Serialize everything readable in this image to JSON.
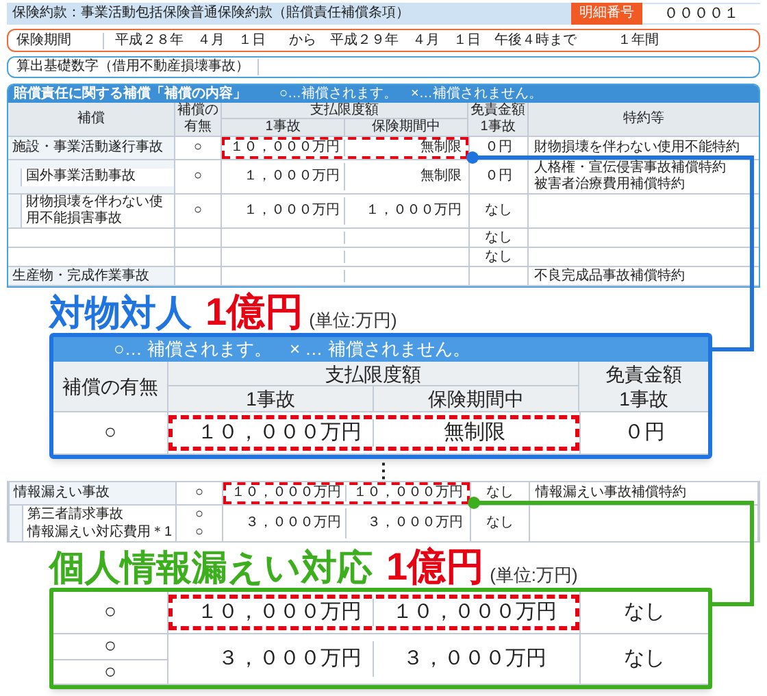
{
  "header": {
    "title": "保険約款：事業活動包括保険普通保険約款（賠償責任補償条項）",
    "badge": "明細番号",
    "number": "００００１"
  },
  "period": {
    "label": "保険期間",
    "start": "平成２８年　４月　１日",
    "end": "から　平成２９年　４月　１日　午後４時まで",
    "length": "１年間"
  },
  "basis": {
    "label": "算出基礎数字（借用不動産損壊事故）"
  },
  "section": {
    "title": "賠償責任に関する補償「補償の内容」",
    "legend": "○…補償されます。　×…補償されません。"
  },
  "columns": {
    "coverage": "補償",
    "availability": "補償の有無",
    "limit": "支払限度額",
    "per_accident": "1事故",
    "per_period": "保険期間中",
    "deductible": "免責金額",
    "deductible_sub": "1事故",
    "riders": "特約等"
  },
  "rows": [
    {
      "sub": false,
      "highlighted": true,
      "items": [
        {
          "label": "施設・事業活動遂行事故",
          "mark": "○"
        }
      ],
      "per_accident": "１０，０００万円",
      "per_period": "無制限",
      "deductible": "０円",
      "riders": [
        "財物損壊を伴わない使用不能特約"
      ]
    },
    {
      "sub": true,
      "highlighted": false,
      "items": [
        {
          "label": "国外事業活動事故",
          "mark": "○"
        }
      ],
      "per_accident": "１，０００万円",
      "per_period": "無制限",
      "deductible": "０円",
      "riders": [
        "人格権・宣伝侵害事故補償特約",
        "被害者治療費用補償特約"
      ]
    },
    {
      "sub": true,
      "highlighted": false,
      "items": [
        {
          "label": "財物損壊を伴わない使用不能損害事故",
          "mark": "○"
        }
      ],
      "per_accident": "１，０００万円",
      "per_period": "１，０００万円",
      "deductible": "なし"
    },
    {
      "highlighted": false,
      "deductible": "なし"
    },
    {
      "highlighted": false,
      "deductible": "なし"
    },
    {
      "sub": false,
      "highlighted": false,
      "items": [
        {
          "label": "生産物・完成作業事故"
        }
      ],
      "riders": [
        "不良完成品事故補償特約"
      ]
    }
  ],
  "callout_1": {
    "heading": "対物対人",
    "amount": "1億円",
    "unit": "(単位:万円)",
    "legend": "○… 補償されます。　× … 補償されません。",
    "columns": {
      "availability": "補償の有無",
      "limit": "支払限度額",
      "per_accident": "1事故",
      "per_period": "保険期間中",
      "deductible": "免責金額",
      "deductible_sub": "1事故"
    },
    "rows": [
      {
        "highlighted": true,
        "marks": [
          "○"
        ],
        "per_accident": "１０，０００万円",
        "per_period": "無制限",
        "deductible": "０円"
      }
    ]
  },
  "ellipsis": "⋮",
  "rows_2": [
    {
      "sub": false,
      "highlighted": true,
      "items": [
        {
          "label": "情報漏えい事故",
          "mark": "○"
        }
      ],
      "per_accident": "１０，０００万円",
      "per_period": "１０，０００万円",
      "deductible": "なし",
      "riders": [
        "情報漏えい事故補償特約"
      ]
    },
    {
      "sub": true,
      "highlighted": false,
      "items": [
        {
          "label": "第三者請求事故",
          "mark": "○"
        },
        {
          "label": "情報漏えい対応費用＊1",
          "mark": "○"
        }
      ],
      "per_accident": "３，０００万円",
      "per_period": "３，０００万円",
      "deductible": "なし"
    }
  ],
  "callout_2": {
    "heading": "個人情報漏えい対応",
    "amount": "1億円",
    "unit": "(単位:万円)",
    "rows": [
      {
        "highlighted": true,
        "marks": [
          "○"
        ],
        "per_accident": "１０，０００万円",
        "per_period": "１０，０００万円",
        "deductible": "なし"
      },
      {
        "highlighted": false,
        "marks": [
          "○",
          "○"
        ],
        "per_accident": "３，０００万円",
        "per_period": "３，０００万円",
        "deductible": "なし"
      }
    ]
  }
}
